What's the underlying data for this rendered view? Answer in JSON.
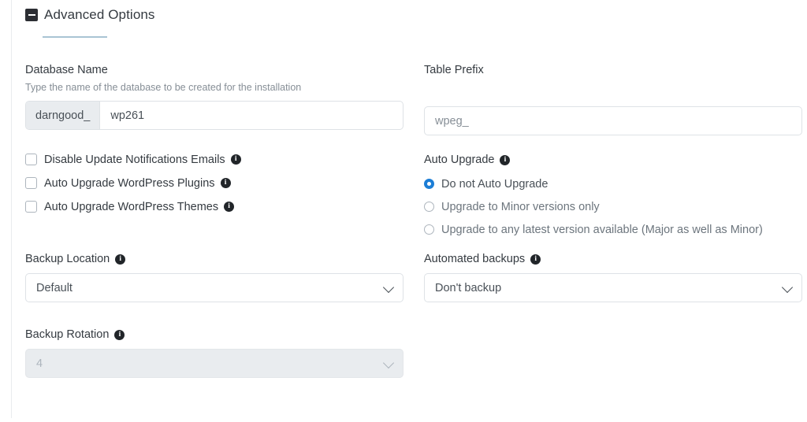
{
  "section": {
    "title": "Advanced Options",
    "collapse_icon": "minus-square-icon",
    "accent_color": "#a9c4d4"
  },
  "fields": {
    "database_name": {
      "label": "Database Name",
      "help": "Type the name of the database to be created for the installation",
      "prefix": "darngood_",
      "value": "wp261"
    },
    "table_prefix": {
      "label": "Table Prefix",
      "value": "wpeg_"
    },
    "backup_location": {
      "label": "Backup Location",
      "value": "Default",
      "info_icon": "info-circle-icon"
    },
    "automated_backups": {
      "label": "Automated backups",
      "value": "Don't backup",
      "info_icon": "info-circle-icon"
    },
    "backup_rotation": {
      "label": "Backup Rotation",
      "value": "4",
      "disabled": true,
      "info_icon": "info-circle-icon"
    }
  },
  "checkboxes": [
    {
      "label": "Disable Update Notifications Emails",
      "checked": false,
      "info_icon": "info-circle-icon"
    },
    {
      "label": "Auto Upgrade WordPress Plugins",
      "checked": false,
      "info_icon": "info-circle-icon"
    },
    {
      "label": "Auto Upgrade WordPress Themes",
      "checked": false,
      "info_icon": "info-circle-icon"
    }
  ],
  "auto_upgrade": {
    "label": "Auto Upgrade",
    "info_icon": "info-circle-icon",
    "selected_color": "#1c7ed6",
    "options": [
      {
        "label": "Do not Auto Upgrade",
        "selected": true
      },
      {
        "label": "Upgrade to Minor versions only",
        "selected": false
      },
      {
        "label": "Upgrade to any latest version available (Major as well as Minor)",
        "selected": false
      }
    ]
  }
}
